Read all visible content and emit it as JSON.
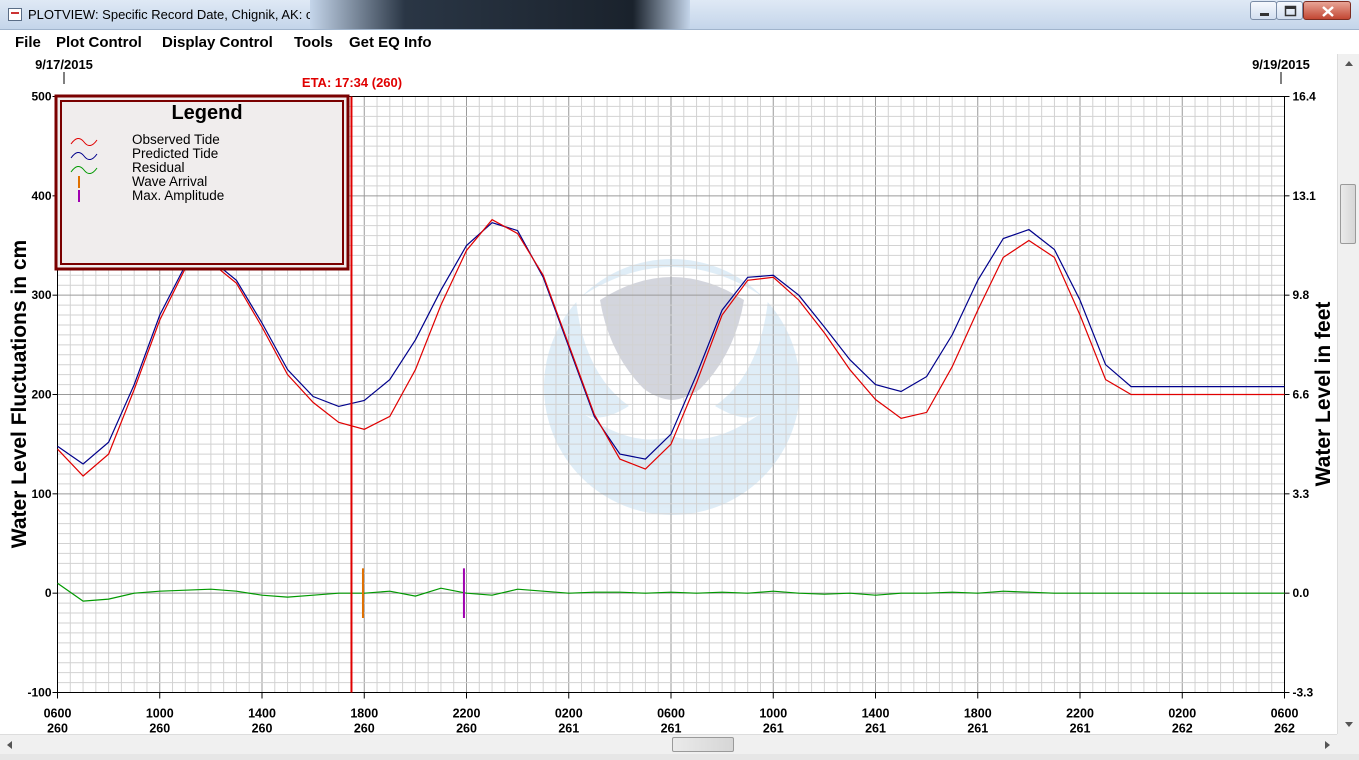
{
  "window": {
    "title": "PLOTVIEW: Specific Record Date, Chignik, AK: chigC"
  },
  "menu": {
    "items": [
      "File",
      "Plot Control",
      "Display Control",
      "Tools",
      "Get EQ Info"
    ]
  },
  "chart_data": {
    "type": "line",
    "ylabel": "Water Level Fluctuations in cm",
    "ylabel_right": "Water Level in feet",
    "ylim": [
      -100,
      500
    ],
    "y_ticks": [
      -100,
      0,
      100,
      200,
      300,
      400,
      500
    ],
    "y_ticks_right": [
      "-3.3",
      "0.0",
      "3.3",
      "6.6",
      "9.8",
      "13.1",
      "16.4"
    ],
    "xlim_hours": [
      0,
      48
    ],
    "x_ticks": [
      {
        "time": "0600",
        "day": "260"
      },
      {
        "time": "1000",
        "day": "260"
      },
      {
        "time": "1400",
        "day": "260"
      },
      {
        "time": "1800",
        "day": "260"
      },
      {
        "time": "2200",
        "day": "260"
      },
      {
        "time": "0200",
        "day": "261"
      },
      {
        "time": "0600",
        "day": "261"
      },
      {
        "time": "1000",
        "day": "261"
      },
      {
        "time": "1400",
        "day": "261"
      },
      {
        "time": "1800",
        "day": "261"
      },
      {
        "time": "2200",
        "day": "261"
      },
      {
        "time": "0200",
        "day": "262"
      },
      {
        "time": "0600",
        "day": "262"
      }
    ],
    "date_start": "9/17/2015",
    "date_end": "9/19/2015",
    "grid": true,
    "eta": {
      "label": "ETA: 17:34 (260)",
      "x_hour": 11.5
    },
    "wave_arrival": {
      "x_hour": 11.95,
      "y_range": [
        -25,
        25
      ]
    },
    "max_amplitude": {
      "x_hour": 15.9,
      "y_range": [
        -25,
        25
      ]
    },
    "legend": {
      "title": "Legend",
      "placement": "top-left",
      "entries": [
        {
          "label": "Observed Tide",
          "color": "#e00000"
        },
        {
          "label": "Predicted Tide",
          "color": "#00008b"
        },
        {
          "label": "Residual",
          "color": "#009900"
        },
        {
          "label": "Wave Arrival",
          "color": "#e07000"
        },
        {
          "label": "Max. Amplitude",
          "color": "#a000b0"
        }
      ]
    },
    "series": [
      {
        "name": "Predicted Tide",
        "color": "#00008b",
        "x": [
          0,
          1,
          2,
          3,
          4,
          5,
          6,
          7,
          8,
          9,
          10,
          11,
          12,
          13,
          14,
          15,
          16,
          17,
          18,
          19,
          20,
          21,
          22,
          23,
          24,
          25,
          26,
          27,
          28,
          29,
          30,
          31,
          32,
          33,
          34,
          35,
          36,
          37,
          38,
          39,
          40,
          41,
          42,
          43,
          44,
          45,
          46,
          47,
          48
        ],
        "y": [
          148,
          130,
          152,
          210,
          280,
          330,
          336,
          315,
          272,
          225,
          198,
          188,
          194,
          215,
          255,
          305,
          350,
          373,
          365,
          318,
          248,
          178,
          140,
          135,
          160,
          220,
          285,
          318,
          320,
          300,
          268,
          235,
          210,
          203,
          218,
          260,
          315,
          357,
          366,
          346,
          295,
          230,
          208,
          208,
          208,
          208,
          208,
          208,
          208
        ]
      },
      {
        "name": "Observed Tide",
        "color": "#e00000",
        "x": [
          0,
          1,
          2,
          3,
          4,
          5,
          6,
          7,
          8,
          9,
          10,
          11,
          12,
          13,
          14,
          15,
          16,
          17,
          18,
          19,
          20,
          21,
          22,
          23,
          24,
          25,
          26,
          27,
          28,
          29,
          30,
          31,
          32,
          33,
          34,
          35,
          36,
          37,
          38,
          39,
          40,
          41,
          42,
          43,
          44,
          45,
          46,
          47,
          48
        ],
        "y": [
          145,
          118,
          140,
          205,
          275,
          327,
          333,
          312,
          268,
          220,
          192,
          172,
          165,
          178,
          225,
          290,
          345,
          376,
          362,
          320,
          250,
          180,
          135,
          125,
          150,
          212,
          280,
          315,
          318,
          295,
          262,
          225,
          195,
          176,
          182,
          228,
          285,
          338,
          355,
          338,
          280,
          215,
          200,
          200,
          200,
          200,
          200,
          200,
          200
        ]
      },
      {
        "name": "Residual",
        "color": "#009900",
        "x": [
          0,
          1,
          2,
          3,
          4,
          5,
          6,
          7,
          8,
          9,
          10,
          11,
          12,
          13,
          14,
          15,
          16,
          17,
          18,
          19,
          20,
          21,
          22,
          23,
          24,
          25,
          26,
          27,
          28,
          29,
          30,
          31,
          32,
          33,
          34,
          35,
          36,
          37,
          38,
          39,
          40,
          41,
          42,
          43,
          44,
          45,
          46,
          47,
          48
        ],
        "y": [
          10,
          -8,
          -6,
          0,
          2,
          3,
          4,
          2,
          -2,
          -4,
          -2,
          0,
          0,
          2,
          -3,
          5,
          0,
          -2,
          4,
          2,
          0,
          1,
          1,
          0,
          1,
          0,
          1,
          0,
          2,
          0,
          -1,
          0,
          -2,
          0,
          0,
          1,
          0,
          2,
          1,
          0,
          0,
          0,
          0,
          0,
          0,
          0,
          0,
          0,
          0
        ]
      }
    ]
  }
}
